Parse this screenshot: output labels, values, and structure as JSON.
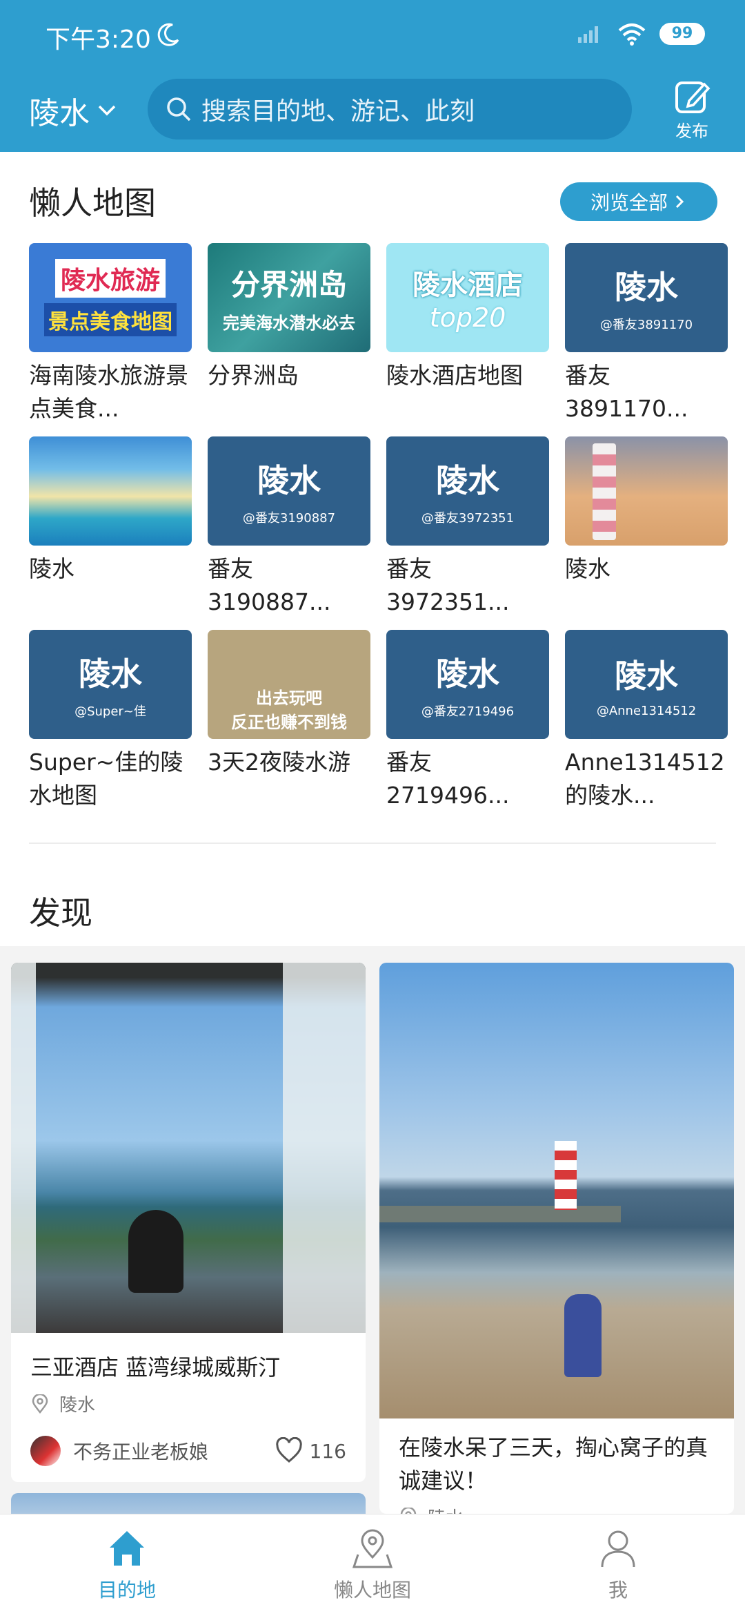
{
  "status": {
    "time": "下午3:20",
    "battery": "99"
  },
  "header": {
    "city": "陵水",
    "search_placeholder": "搜索目的地、游记、此刻",
    "publish_label": "发布"
  },
  "lazy_map": {
    "title": "懒人地图",
    "browse_all": "浏览全部",
    "items": [
      {
        "title": "海南陵水旅游景点美食...",
        "thumb_line1": "陵水旅游",
        "thumb_line2": "景点美食地图"
      },
      {
        "title": "分界洲岛",
        "thumb_line1": "分界洲岛",
        "thumb_line2": "完美海水潜水必去"
      },
      {
        "title": "陵水酒店地图",
        "thumb_line1": "陵水酒店",
        "thumb_line2": "top20"
      },
      {
        "title": "番友3891170...",
        "thumb_line1": "陵水",
        "thumb_line2": "@番友3891170"
      },
      {
        "title": "陵水"
      },
      {
        "title": "番友3190887...",
        "thumb_line1": "陵水",
        "thumb_line2": "@番友3190887"
      },
      {
        "title": "番友3972351...",
        "thumb_line1": "陵水",
        "thumb_line2": "@番友3972351"
      },
      {
        "title": "陵水"
      },
      {
        "title": "Super~佳的陵水地图",
        "thumb_line1": "陵水",
        "thumb_line2": "@Super~佳"
      },
      {
        "title": "3天2夜陵水游",
        "thumb_line1": "出去玩吧",
        "thumb_line2": "反正也赚不到钱"
      },
      {
        "title": "番友2719496...",
        "thumb_line1": "陵水",
        "thumb_line2": "@番友2719496"
      },
      {
        "title": "Anne1314512的陵水...",
        "thumb_line1": "陵水",
        "thumb_line2": "@Anne1314512"
      }
    ]
  },
  "discover": {
    "title": "发现",
    "posts": [
      {
        "title": "三亚酒店 蓝湾绿城威斯汀",
        "location": "陵水",
        "author": "不务正业老板娘",
        "likes": "116"
      },
      {
        "title": "在陵水呆了三天，掏心窝子的真诚建议！",
        "location": "陵水"
      }
    ]
  },
  "nav": {
    "items": [
      {
        "label": "目的地",
        "icon": "home-icon",
        "active": true
      },
      {
        "label": "懒人地图",
        "icon": "map-pin-icon",
        "active": false
      },
      {
        "label": "我",
        "icon": "person-icon",
        "active": false
      }
    ]
  },
  "colors": {
    "brand": "#2e9ecf",
    "tile_blue": "#2f5f8a"
  }
}
